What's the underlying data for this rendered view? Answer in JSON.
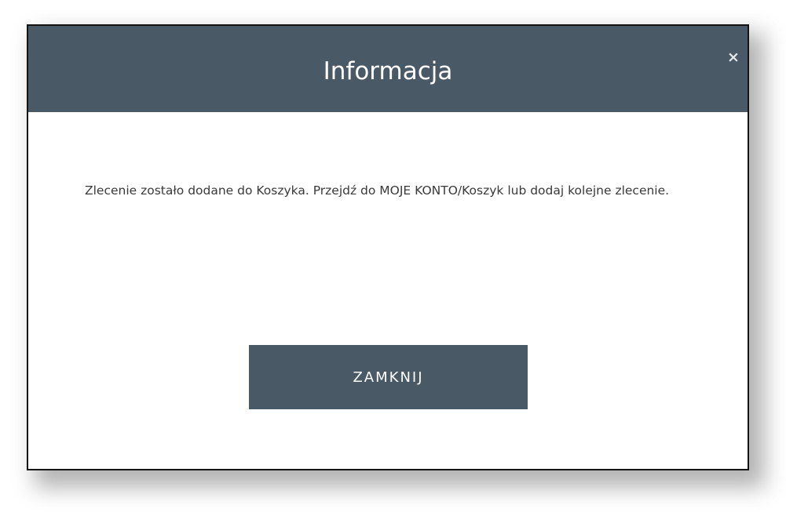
{
  "dialog": {
    "title": "Informacja",
    "close_icon": "×",
    "message": "Zlecenie zostało dodane do Koszyka. Przejdź do MOJE KONTO/Koszyk lub dodaj kolejne zlecenie.",
    "button_label": "ZAMKNIJ"
  },
  "colors": {
    "header": "#4a5966",
    "button": "#4a5966",
    "border": "#141414",
    "text": "#3a3a3a"
  },
  "icons": {
    "close": "close-icon"
  }
}
